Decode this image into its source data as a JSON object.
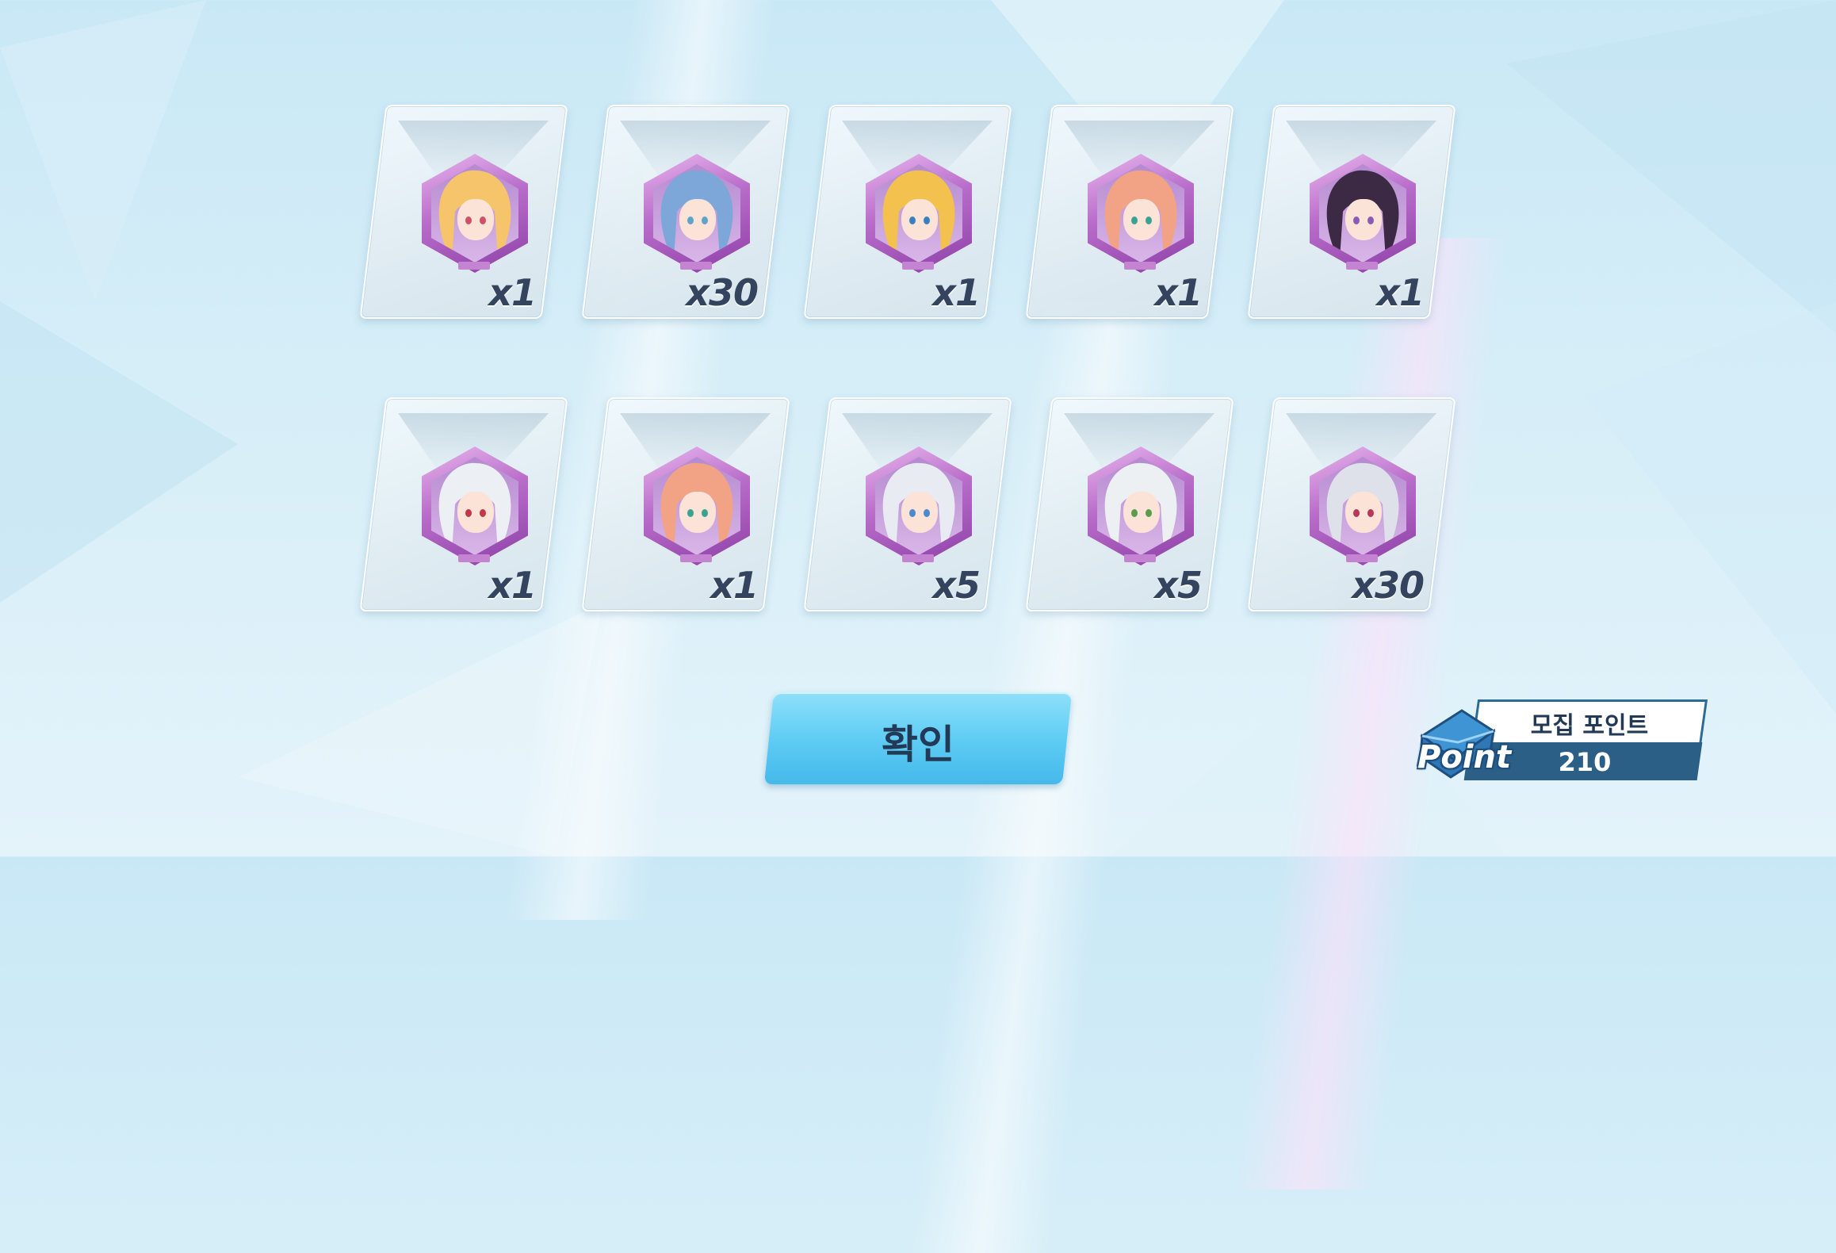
{
  "rewards": [
    {
      "quantity": "x1",
      "portrait": "character-portrait-blonde-glasses"
    },
    {
      "quantity": "x30",
      "portrait": "character-portrait-blue-hair"
    },
    {
      "quantity": "x1",
      "portrait": "character-portrait-blonde-ponytail"
    },
    {
      "quantity": "x1",
      "portrait": "character-portrait-pink-hair-glasses"
    },
    {
      "quantity": "x1",
      "portrait": "character-portrait-dark-hair"
    },
    {
      "quantity": "x1",
      "portrait": "character-portrait-white-hair"
    },
    {
      "quantity": "x1",
      "portrait": "character-portrait-pink-hair-glasses"
    },
    {
      "quantity": "x5",
      "portrait": "character-portrait-silver-hair-headband"
    },
    {
      "quantity": "x5",
      "portrait": "character-portrait-white-hair-clip"
    },
    {
      "quantity": "x30",
      "portrait": "character-portrait-silver-long-hair"
    }
  ],
  "confirm_button": {
    "label": "확인"
  },
  "recruit_points": {
    "title": "모집 포인트",
    "value": "210",
    "emblem_text": "Point"
  },
  "colors": {
    "card_frame": "#8d3fa6",
    "quantity_text": "#34445e",
    "button": "#5ccbf4",
    "points_bar": "#2c5f86"
  }
}
